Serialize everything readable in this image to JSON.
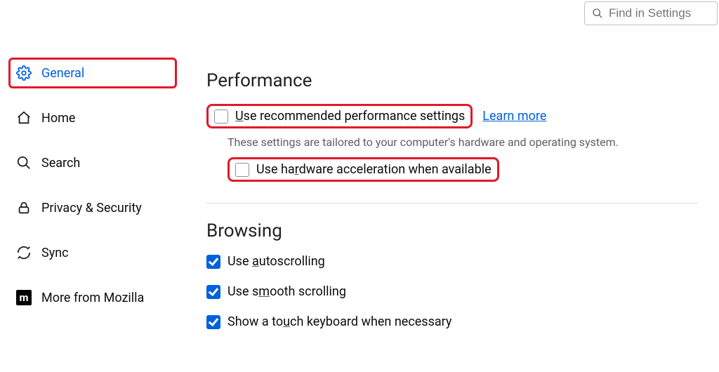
{
  "search": {
    "placeholder": "Find in Settings"
  },
  "sidebar": {
    "items": [
      {
        "label": "General"
      },
      {
        "label": "Home"
      },
      {
        "label": "Search"
      },
      {
        "label": "Privacy & Security"
      },
      {
        "label": "Sync"
      },
      {
        "label": "More from Mozilla"
      }
    ],
    "mozilla_tile": "m"
  },
  "performance": {
    "title": "Performance",
    "use_recommended_pre": "",
    "use_recommended_u": "U",
    "use_recommended_post": "se recommended performance settings",
    "learn_more": "Learn more",
    "desc": "These settings are tailored to your computer's hardware and operating system.",
    "hw_pre": "Use ha",
    "hw_u": "r",
    "hw_post": "dware acceleration when available"
  },
  "browsing": {
    "title": "Browsing",
    "auto_pre": "Use ",
    "auto_u": "a",
    "auto_post": "utoscrolling",
    "smooth_pre": "Use s",
    "smooth_u": "m",
    "smooth_post": "ooth scrolling",
    "touch_pre": "Show a to",
    "touch_u": "u",
    "touch_post": "ch keyboard when necessary"
  }
}
